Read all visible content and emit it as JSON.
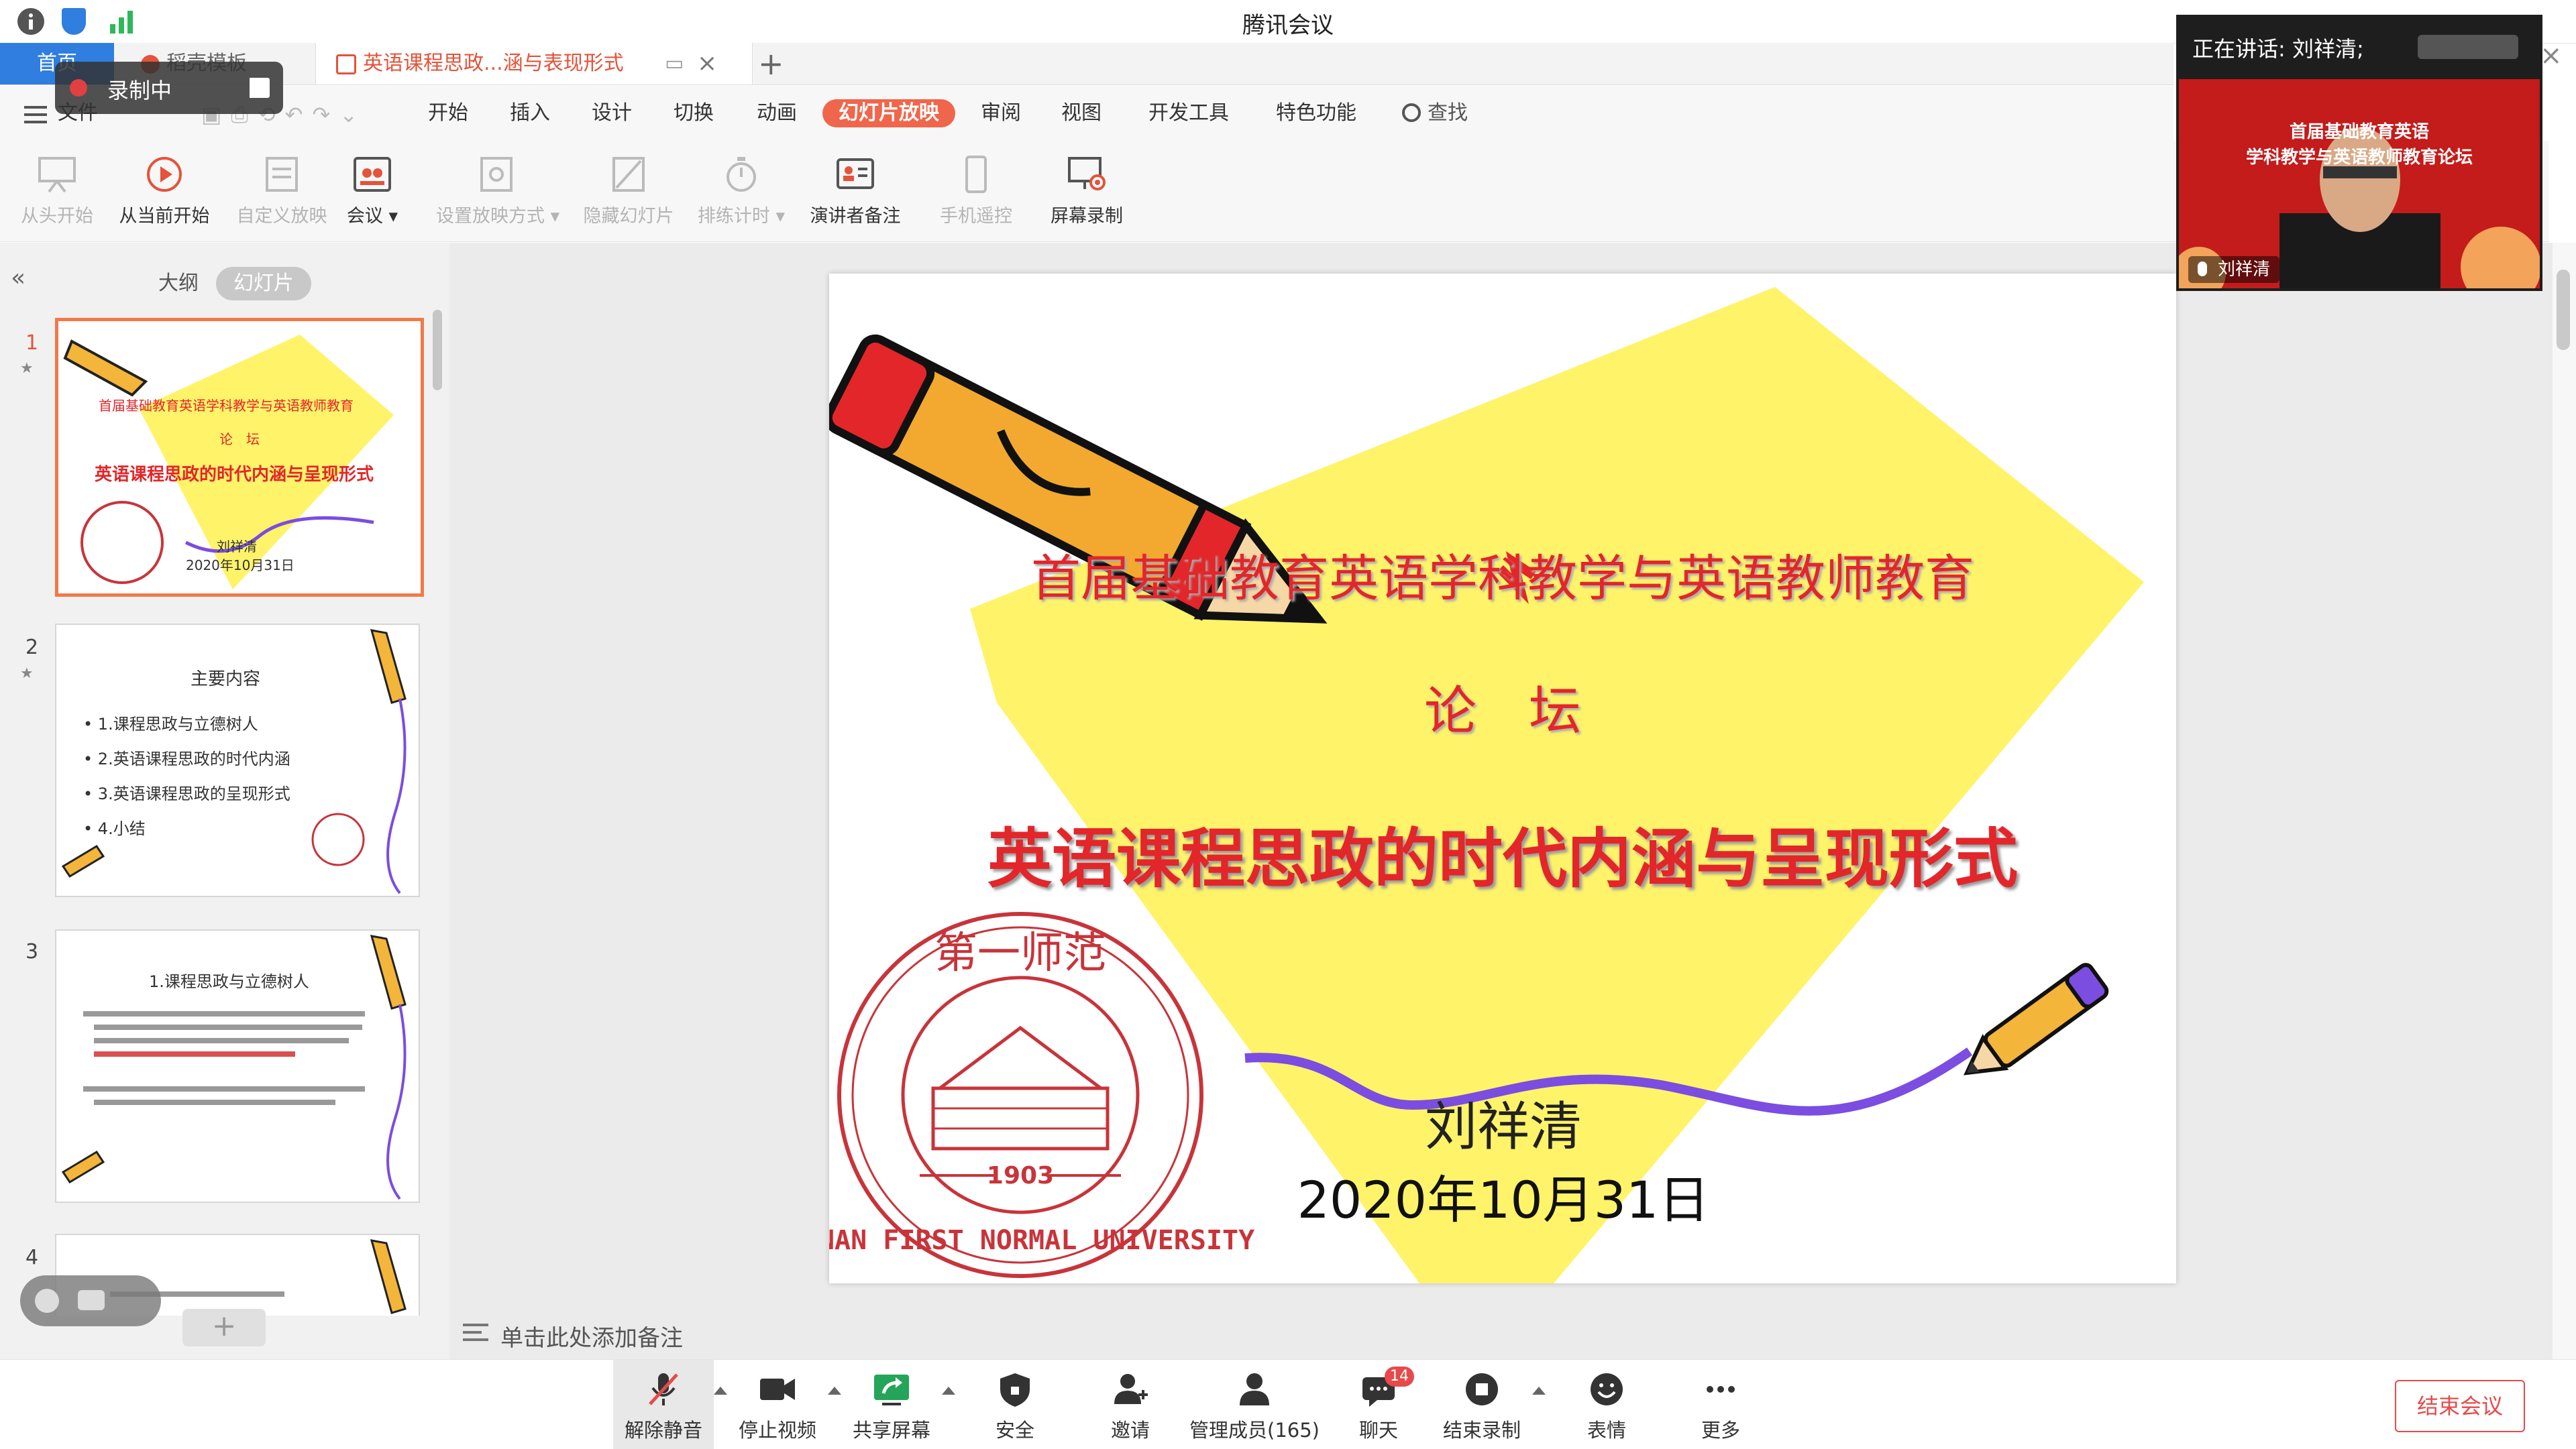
{
  "app": {
    "title": "腾讯会议"
  },
  "tabs": {
    "home": "首页",
    "template": "稻壳模板",
    "document": "英语课程思政...涵与表现形式"
  },
  "recording": {
    "label": "录制中"
  },
  "menu": {
    "items": [
      "文件",
      "开始",
      "插入",
      "设计",
      "切换",
      "动画",
      "幻灯片放映",
      "审阅",
      "视图",
      "开发工具",
      "特色功能"
    ],
    "search": "查找",
    "active": "幻灯片放映"
  },
  "ribbon": {
    "buttons": [
      {
        "label": "从头开始",
        "enabled": false,
        "icon": "projector-icon"
      },
      {
        "label": "从当前开始",
        "enabled": true,
        "icon": "play-icon"
      },
      {
        "label": "自定义放映",
        "enabled": false,
        "icon": "custom-show-icon"
      },
      {
        "label": "会议",
        "enabled": true,
        "icon": "meeting-icon"
      },
      {
        "label": "设置放映方式",
        "enabled": false,
        "icon": "setup-show-icon"
      },
      {
        "label": "隐藏幻灯片",
        "enabled": false,
        "icon": "hide-slide-icon"
      },
      {
        "label": "排练计时",
        "enabled": false,
        "icon": "stopwatch-icon"
      },
      {
        "label": "演讲者备注",
        "enabled": true,
        "icon": "speaker-notes-icon"
      },
      {
        "label": "手机遥控",
        "enabled": false,
        "icon": "phone-remote-icon"
      },
      {
        "label": "屏幕录制",
        "enabled": true,
        "icon": "screen-record-icon"
      }
    ]
  },
  "leftpanel": {
    "tabs": {
      "outline": "大纲",
      "slides": "幻灯片"
    },
    "thumbs": [
      {
        "num": "1",
        "lines": [
          "首届基础教育英语学科教学与英语教师教育",
          "论　坛",
          "英语课程思政的时代内涵与呈现形式",
          "刘祥清",
          "2020年10月31日"
        ]
      },
      {
        "num": "2",
        "title": "主要内容",
        "lines": [
          "1.课程思政与立德树人",
          "2.英语课程思政的时代内涵",
          "3.英语课程思政的呈现形式",
          "4.小结"
        ]
      },
      {
        "num": "3",
        "title": "1.课程思政与立德树人"
      },
      {
        "num": "4"
      }
    ]
  },
  "slide": {
    "line1": "首届基础教育英语学科教学与英语教师教育",
    "line2": "论　坛",
    "title": "英语课程思政的时代内涵与呈现形式",
    "author": "刘祥清",
    "date": "2020年10月31日",
    "seal": {
      "top": "第一师范",
      "ring": "HUNAN FIRST NORMAL UNIVERSITY",
      "year": "1903"
    }
  },
  "notes": {
    "placeholder": "单击此处添加备注"
  },
  "speaker": {
    "header": "正在讲话: 刘祥清;",
    "name": "刘祥清",
    "banner": [
      "首届基础教育英语",
      "学科教学与英语教师教育论坛"
    ]
  },
  "bottombar": {
    "buttons": [
      {
        "label": "解除静音",
        "icon": "mic-muted-icon"
      },
      {
        "label": "停止视频",
        "icon": "video-camera-icon"
      },
      {
        "label": "共享屏幕",
        "icon": "share-screen-icon"
      },
      {
        "label": "安全",
        "icon": "shield-icon"
      },
      {
        "label": "邀请",
        "icon": "invite-user-icon"
      },
      {
        "label": "管理成员(165)",
        "icon": "members-icon"
      },
      {
        "label": "聊天",
        "icon": "chat-icon",
        "badge": "14"
      },
      {
        "label": "结束录制",
        "icon": "stop-record-icon"
      },
      {
        "label": "表情",
        "icon": "emoji-icon"
      },
      {
        "label": "更多",
        "icon": "more-icon"
      }
    ],
    "end_meeting": "结束会议"
  },
  "colors": {
    "accent_orange": "#f0664c",
    "slide_red": "#e3262a",
    "slide_yellow": "#fff36a",
    "seal_red": "#c8343a",
    "ribbon_purple": "#7b4de0"
  }
}
